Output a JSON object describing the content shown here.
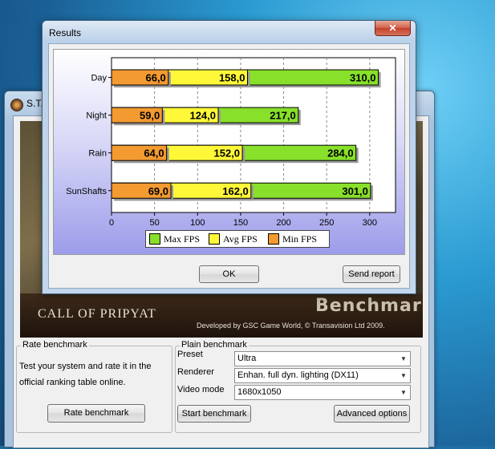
{
  "launcher": {
    "title": "S.T.",
    "banner": {
      "subtitle": "CALL OF PRIPYAT",
      "benchmark": "Benchmark",
      "credits": "Developed by GSC Game World, © Transavision Ltd 2009."
    },
    "rate": {
      "legend": "Rate benchmark",
      "description": "Test your system and rate it in the official ranking table online.",
      "button": "Rate benchmark"
    },
    "plain": {
      "legend": "Plain benchmark",
      "preset_label": "Preset",
      "preset_value": "Ultra",
      "renderer_label": "Renderer",
      "renderer_value": "Enhan. full dyn. lighting (DX11)",
      "video_label": "Video mode",
      "video_value": "1680x1050",
      "start_button": "Start benchmark",
      "advanced_button": "Advanced options"
    }
  },
  "results": {
    "title": "Results",
    "close_glyph": "✕",
    "ok_button": "OK",
    "send_button": "Send report"
  },
  "chart_data": {
    "type": "bar",
    "orientation": "horizontal",
    "stacking": "overlay",
    "categories": [
      "Day",
      "Night",
      "Rain",
      "SunShafts"
    ],
    "series": [
      {
        "name": "Max FPS",
        "values": [
          310.0,
          217.0,
          284.0,
          301.0
        ],
        "labels": [
          "310,0",
          "217,0",
          "284,0",
          "301,0"
        ],
        "color": "#88e02a"
      },
      {
        "name": "Avg FPS",
        "values": [
          158.0,
          124.0,
          152.0,
          162.0
        ],
        "labels": [
          "158,0",
          "124,0",
          "152,0",
          "162,0"
        ],
        "color": "#fff838"
      },
      {
        "name": "Min FPS",
        "values": [
          66.0,
          59.0,
          64.0,
          69.0
        ],
        "labels": [
          "66,0",
          "59,0",
          "64,0",
          "69,0"
        ],
        "color": "#f39a30"
      }
    ],
    "xlim": [
      0,
      330
    ],
    "xticks": [
      "0",
      "50",
      "100",
      "150",
      "200",
      "250",
      "300"
    ],
    "xtick_values": [
      0,
      50,
      100,
      150,
      200,
      250,
      300
    ],
    "grid": "vertical dashed",
    "legend_position": "bottom"
  }
}
